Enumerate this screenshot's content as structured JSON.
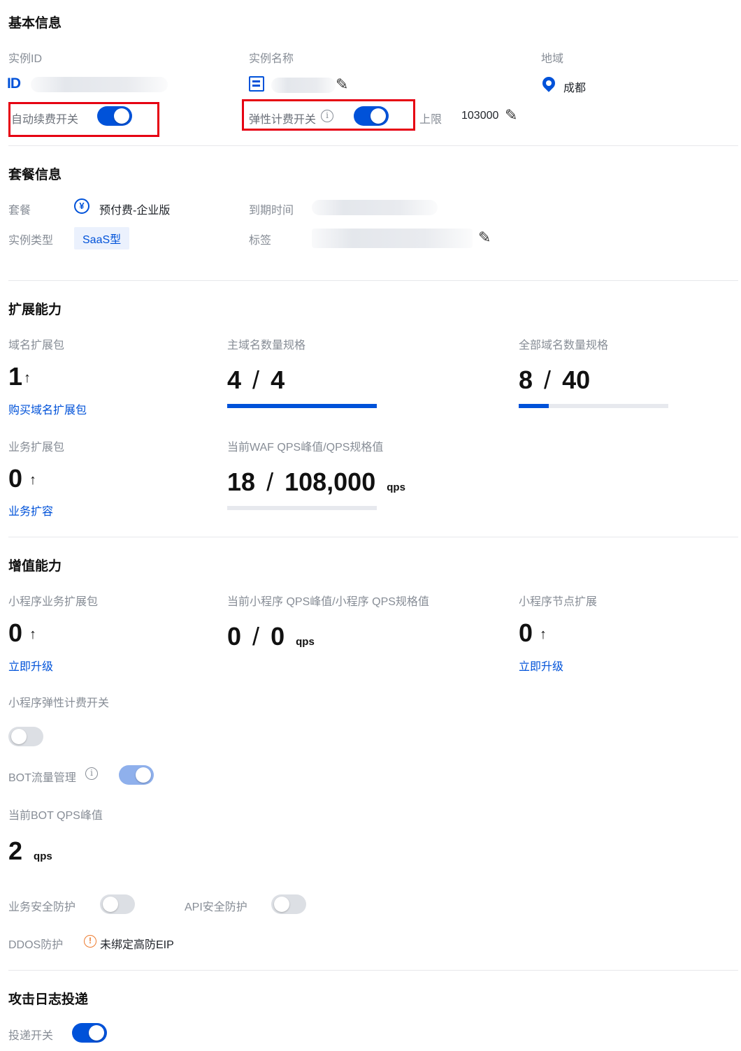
{
  "basic": {
    "title": "基本信息",
    "instance_id_label": "实例ID",
    "instance_name_label": "实例名称",
    "region_label": "地域",
    "region_value": "成都",
    "auto_renew_label": "自动续费开关",
    "elastic_billing_label": "弹性计费开关",
    "limit_label": "上限",
    "limit_value": "103000"
  },
  "package": {
    "title": "套餐信息",
    "plan_label": "套餐",
    "plan_value": "预付费-企业版",
    "expire_label": "到期时间",
    "instance_type_label": "实例类型",
    "instance_type_value": "SaaS型",
    "tags_label": "标签"
  },
  "extend": {
    "title": "扩展能力",
    "domain_pack_label": "域名扩展包",
    "domain_pack_value": "1",
    "buy_domain_link": "购买域名扩展包",
    "main_domain_label": "主域名数量规格",
    "main_domain_used": "4",
    "main_domain_total": "4",
    "main_domain_progress": 1.0,
    "all_domain_label": "全部域名数量规格",
    "all_domain_used": "8",
    "all_domain_total": "40",
    "all_domain_progress": 0.2,
    "biz_pack_label": "业务扩展包",
    "biz_pack_value": "0",
    "biz_expand_link": "业务扩容",
    "waf_qps_label": "当前WAF QPS峰值/QPS规格值",
    "waf_qps_used": "18",
    "waf_qps_total": "108,000",
    "waf_qps_unit": "qps",
    "waf_qps_progress": 0.0
  },
  "value_added": {
    "title": "增值能力",
    "mini_pack_label": "小程序业务扩展包",
    "mini_pack_value": "0",
    "mini_upgrade_link": "立即升级",
    "mini_qps_label": "当前小程序 QPS峰值/小程序 QPS规格值",
    "mini_qps_used": "0",
    "mini_qps_total": "0",
    "mini_qps_unit": "qps",
    "mini_node_label": "小程序节点扩展",
    "mini_node_value": "0",
    "mini_node_upgrade_link": "立即升级",
    "mini_elastic_label": "小程序弹性计费开关",
    "bot_label": "BOT流量管理",
    "bot_qps_label": "当前BOT QPS峰值",
    "bot_qps_value": "2",
    "bot_qps_unit": "qps",
    "biz_security_label": "业务安全防护",
    "api_security_label": "API安全防护",
    "ddos_label": "DDOS防护",
    "ddos_value": "未绑定高防EIP"
  },
  "log": {
    "title": "攻击日志投递",
    "delivery_label": "投递开关"
  },
  "glyphs": {
    "up_arrow": "↑",
    "slash": "/",
    "info": "i",
    "pencil": "✎",
    "yen": "¥",
    "warn": "!",
    "id": "ID"
  },
  "colors": {
    "accent": "#0052d9",
    "highlight_box": "#e60012",
    "warning": "#ed7b2f"
  }
}
